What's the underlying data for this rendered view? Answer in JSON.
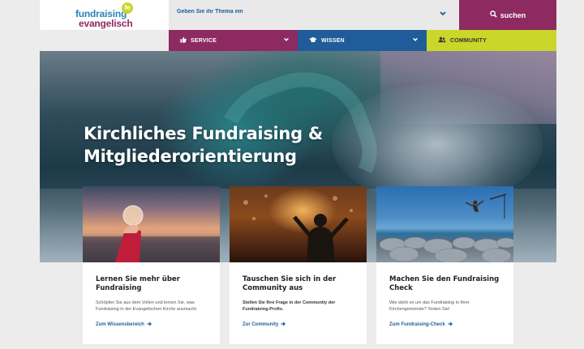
{
  "logo": {
    "line1": "fundraising",
    "line2": "evangelisch",
    "mark": "fe"
  },
  "search": {
    "placeholder": "Geben Sie ihr Thema ein",
    "button_label": "suchen"
  },
  "nav": {
    "items": [
      {
        "label": "SERVICE",
        "icon": "thumbs-up-icon"
      },
      {
        "label": "WISSEN",
        "icon": "graduation-cap-icon"
      },
      {
        "label": "COMMUNITY",
        "icon": "users-icon"
      }
    ]
  },
  "hero": {
    "title": "Kirchliches Fundraising & Mitgliederorientierung"
  },
  "cards": [
    {
      "title": "Lernen Sie mehr über Fundraising",
      "text": "Schöpfen Sie aus dem Vollen und lernen Sie, was Fundraising in der Evangelischen Kirche ausmacht.",
      "link": "Zum Wissensbereich"
    },
    {
      "title": "Tauschen Sie sich in der Community aus",
      "text": "Stellen Sie Ihre Frage in der Community der Fundraising-Profis.",
      "link": "Zur Community"
    },
    {
      "title": "Machen Sie den Fundraising Check",
      "text": "Wie steht es um das Fundraising in Ihrer Kirchengemeinde? Testen Sie!",
      "link": "Zum Fundraising-Check"
    }
  ],
  "colors": {
    "purple": "#8e2a62",
    "blue": "#1f5c99",
    "lime": "#cad62a"
  }
}
